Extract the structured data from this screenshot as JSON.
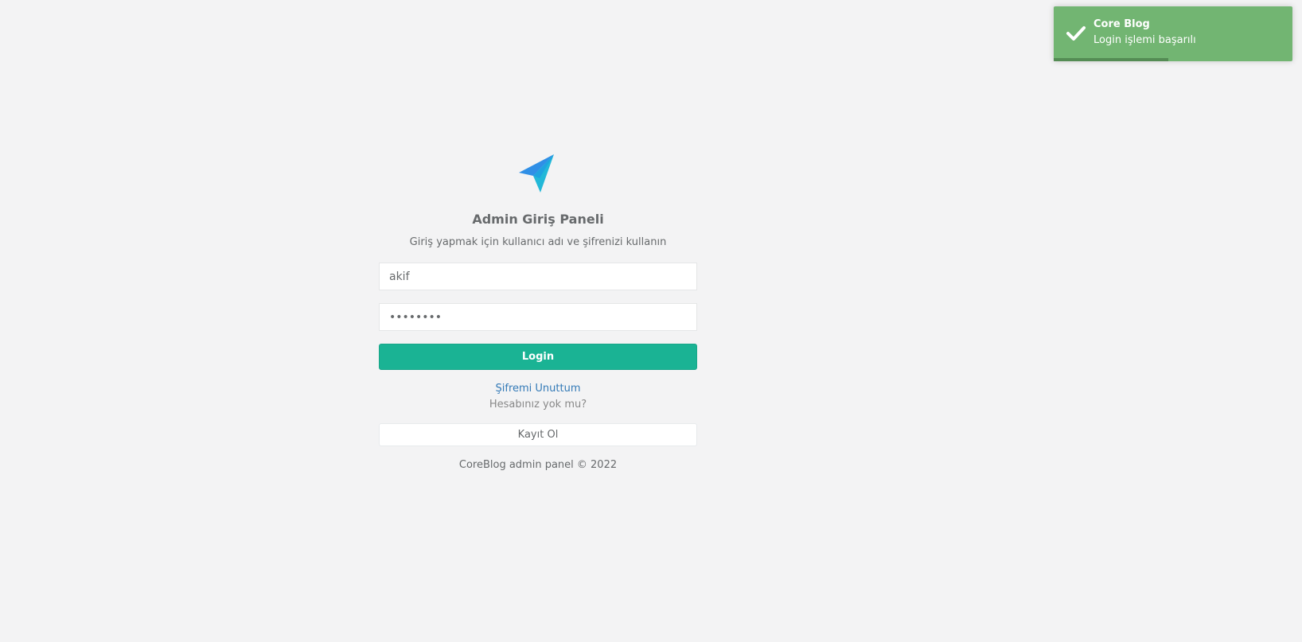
{
  "toast": {
    "title": "Core Blog",
    "message": "Login işlemi başarılı",
    "icon": "check-icon",
    "background_color": "#72b572",
    "progress": 0.48
  },
  "login": {
    "logo_icon": "paper-plane-icon",
    "title": "Admin Giriş Paneli",
    "subtitle": "Giriş yapmak için kullanıcı adı ve şifrenizi kullanın",
    "username_value": "akif",
    "password_value": "••••••••",
    "login_button": "Login",
    "forgot_link": "Şifremi Unuttum",
    "no_account_text": "Hesabınız yok mu?",
    "register_button": "Kayıt Ol",
    "footer": "CoreBlog admin panel © 2022",
    "accent_color": "#1ab394"
  }
}
